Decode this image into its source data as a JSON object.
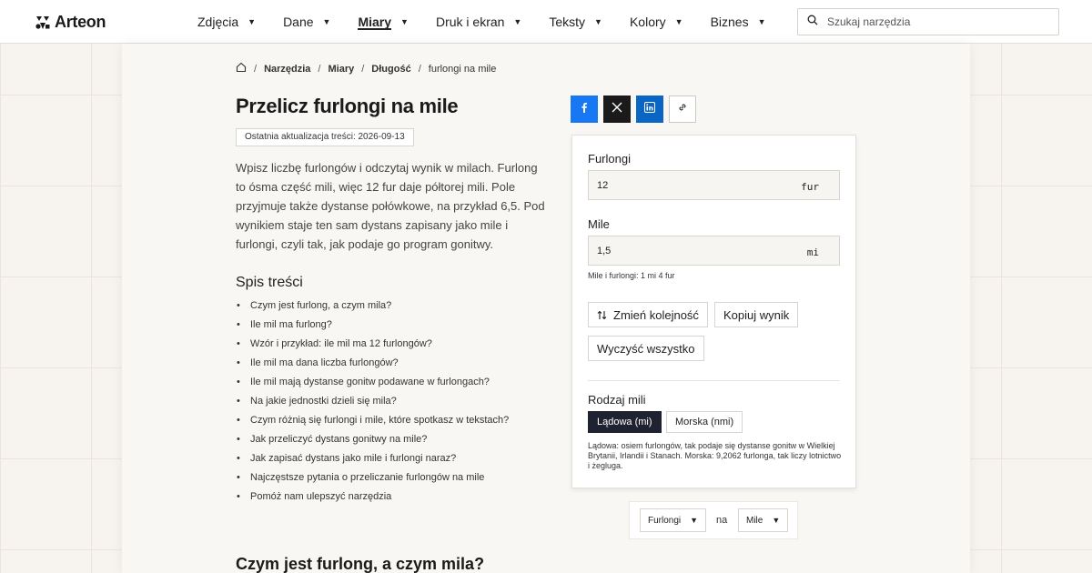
{
  "brand": {
    "name": "Arteon"
  },
  "nav": {
    "items": [
      {
        "label": "Zdjęcia",
        "active": false
      },
      {
        "label": "Dane",
        "active": false
      },
      {
        "label": "Miary",
        "active": true
      },
      {
        "label": "Druk i ekran",
        "active": false
      },
      {
        "label": "Teksty",
        "active": false
      },
      {
        "label": "Kolory",
        "active": false
      },
      {
        "label": "Biznes",
        "active": false
      }
    ],
    "caret": "▼"
  },
  "search": {
    "placeholder": "Szukaj narzędzia",
    "icon": "search-icon"
  },
  "breadcrumb": {
    "home_icon": "home-icon",
    "separator": "/",
    "items": [
      "Narzędzia",
      "Miary",
      "Długość"
    ],
    "current": "furlongi na mile"
  },
  "page": {
    "title": "Przelicz furlongi na mile",
    "updated": "Ostatnia aktualizacja treści: 2026-09-13",
    "intro": "Wpisz liczbę furlongów i odczytaj wynik w milach. Furlong to ósma część mili, więc 12 fur daje półtorej mili. Pole przyjmuje także dystanse połówkowe, na przykład 6,5. Pod wynikiem staje ten sam dystans zapisany jako mile i furlongi, czyli tak, jak podaje go program gonitwy.",
    "toc_title": "Spis treści",
    "toc": [
      "Czym jest furlong, a czym mila?",
      "Ile mil ma furlong?",
      "Wzór i przykład: ile mil ma 12 furlongów?",
      "Ile mil ma dana liczba furlongów?",
      "Ile mil mają dystanse gonitw podawane w furlongach?",
      "Na jakie jednostki dzieli się mila?",
      "Czym różnią się furlongi i mile, które spotkasz w tekstach?",
      "Jak przeliczyć dystans gonitwy na mile?",
      "Jak zapisać dystans jako mile i furlongi naraz?",
      "Najczęstsze pytania o przeliczanie furlongów na mile",
      "Pomóż nam ulepszyć narzędzia"
    ],
    "section_heading": "Czym jest furlong, a czym mila?"
  },
  "share": {
    "buttons": [
      {
        "name": "facebook-share-button",
        "icon": "facebook-icon",
        "color": "#1877f2"
      },
      {
        "name": "x-share-button",
        "icon": "x-icon",
        "color": "#1a1a1a"
      },
      {
        "name": "linkedin-share-button",
        "icon": "linkedin-icon",
        "color": "#0a66c2"
      },
      {
        "name": "copy-link-button",
        "icon": "link-icon",
        "color": "#ffffff"
      }
    ]
  },
  "converter": {
    "from": {
      "label": "Furlongi",
      "value": "12",
      "unit": "fur"
    },
    "to": {
      "label": "Mile",
      "value": "1,5",
      "unit": "mi"
    },
    "result_note": "Mile i furlongi: 1 mi 4 fur",
    "swap_label": "Zmień kolejność",
    "copy_label": "Kopiuj wynik",
    "clear_label": "Wyczyść wszystko",
    "mile_type": {
      "label": "Rodzaj mili",
      "options": [
        {
          "label": "Lądowa (mi)",
          "selected": true
        },
        {
          "label": "Morska (nmi)",
          "selected": false
        }
      ],
      "note": "Lądowa: osiem furlongów, tak podaje się dystanse gonitw w Wielkiej Brytanii, Irlandii i Stanach. Morska: 9,2062 furlonga, tak liczy lotnictwo i żegluga."
    }
  },
  "unit_selector": {
    "from": "Furlongi",
    "connector": "na",
    "to": "Mile",
    "caret": "▼"
  },
  "colors": {
    "accent_dark": "#1f2230",
    "facebook": "#1877f2",
    "linkedin": "#0a66c2"
  }
}
